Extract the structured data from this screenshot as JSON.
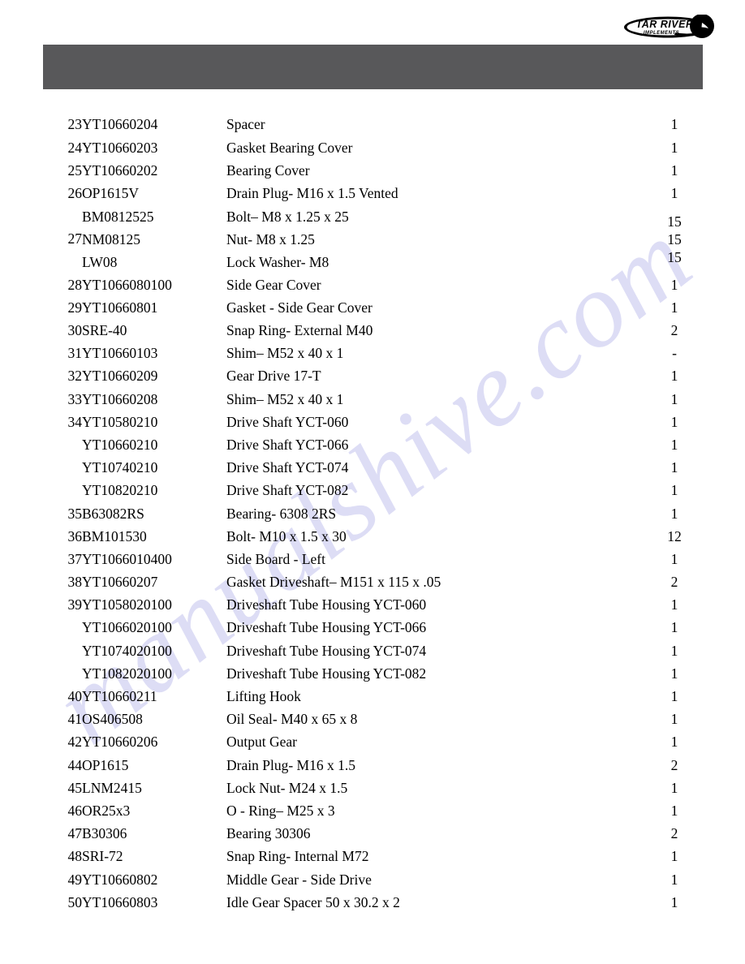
{
  "document": {
    "type": "parts-list-page",
    "logo": {
      "primary_text": "TAR RIVER",
      "secondary_text": "IMPLEMENTS"
    },
    "watermark": "manualshive.com",
    "header_bar_color": "#58585a",
    "page_background": "#ffffff"
  },
  "table": {
    "rows": [
      {
        "item": "23",
        "part": "YT10660204",
        "desc": "Spacer",
        "qty": "1"
      },
      {
        "item": "24",
        "part": "YT10660203",
        "desc": "Gasket Bearing Cover",
        "qty": "1"
      },
      {
        "item": "25",
        "part": "YT10660202",
        "desc": "Bearing Cover",
        "qty": "1"
      },
      {
        "item": "26",
        "part": "OP1615V",
        "desc": "Drain Plug- M16 x 1.5 Vented",
        "qty": "1"
      },
      {
        "item": "27",
        "group": true,
        "lines": [
          {
            "part": "BM0812525",
            "desc": "Bolt– M8 x 1.25 x 25",
            "qty": "15"
          },
          {
            "part": "NM08125",
            "desc": "Nut- M8 x 1.25",
            "qty": "15"
          },
          {
            "part": "LW08",
            "desc": "Lock Washer- M8",
            "qty": "15"
          }
        ]
      },
      {
        "item": "28",
        "part": "YT1066080100",
        "desc": "Side Gear Cover",
        "qty": "1"
      },
      {
        "item": "29",
        "part": "YT10660801",
        "desc": "Gasket - Side Gear Cover",
        "qty": "1"
      },
      {
        "item": "30",
        "part": "SRE-40",
        "desc": "Snap Ring- External M40",
        "qty": "2"
      },
      {
        "item": "31",
        "part": "YT10660103",
        "desc": "Shim– M52 x 40 x 1",
        "qty": "-"
      },
      {
        "item": "32",
        "part": "YT10660209",
        "desc": "Gear Drive 17-T",
        "qty": "1"
      },
      {
        "item": "33",
        "part": "YT10660208",
        "desc": "Shim– M52 x 40 x 1",
        "qty": "1"
      },
      {
        "item": "34",
        "part": "YT10580210",
        "desc": "Drive Shaft YCT-060",
        "qty": "1"
      },
      {
        "item": "",
        "part": "YT10660210",
        "desc": "Drive Shaft YCT-066",
        "qty": "1"
      },
      {
        "item": "",
        "part": "YT10740210",
        "desc": "Drive Shaft YCT-074",
        "qty": "1"
      },
      {
        "item": "",
        "part": "YT10820210",
        "desc": "Drive Shaft YCT-082",
        "qty": "1"
      },
      {
        "item": "35",
        "part": "B63082RS",
        "desc": "Bearing- 6308 2RS",
        "qty": "1"
      },
      {
        "item": "36",
        "part": "BM101530",
        "desc": "Bolt- M10 x 1.5 x 30",
        "qty": "12"
      },
      {
        "item": "37",
        "part": "YT1066010400",
        "desc": "Side Board - Left",
        "qty": "1"
      },
      {
        "item": "38",
        "part": "YT10660207",
        "desc": "Gasket Driveshaft– M151 x 115 x .05",
        "qty": "2"
      },
      {
        "item": "39",
        "part": "YT1058020100",
        "desc": "Driveshaft Tube Housing YCT-060",
        "qty": "1"
      },
      {
        "item": "",
        "part": "YT1066020100",
        "desc": "Driveshaft Tube Housing YCT-066",
        "qty": "1"
      },
      {
        "item": "",
        "part": "YT1074020100",
        "desc": "Driveshaft Tube Housing YCT-074",
        "qty": "1"
      },
      {
        "item": "",
        "part": "YT1082020100",
        "desc": "Driveshaft Tube Housing YCT-082",
        "qty": "1"
      },
      {
        "item": "40",
        "part": "YT10660211",
        "desc": "Lifting Hook",
        "qty": "1"
      },
      {
        "item": "41",
        "part": "OS406508",
        "desc": "Oil Seal- M40 x 65 x 8",
        "qty": "1"
      },
      {
        "item": "42",
        "part": "YT10660206",
        "desc": "Output Gear",
        "qty": "1"
      },
      {
        "item": "44",
        "part": "OP1615",
        "desc": "Drain Plug- M16 x 1.5",
        "qty": "2"
      },
      {
        "item": "45",
        "part": "LNM2415",
        "desc": "Lock Nut- M24 x 1.5",
        "qty": "1"
      },
      {
        "item": "46",
        "part": "OR25x3",
        "desc": "O - Ring– M25 x 3",
        "qty": "1"
      },
      {
        "item": "47",
        "part": "B30306",
        "desc": "Bearing 30306",
        "qty": "2"
      },
      {
        "item": "48",
        "part": "SRI-72",
        "desc": "Snap Ring- Internal M72",
        "qty": "1"
      },
      {
        "item": "49",
        "part": "YT10660802",
        "desc": "Middle Gear - Side Drive",
        "qty": "1"
      },
      {
        "item": "50",
        "part": "YT10660803",
        "desc": "Idle Gear Spacer 50 x 30.2 x 2",
        "qty": "1"
      }
    ]
  }
}
